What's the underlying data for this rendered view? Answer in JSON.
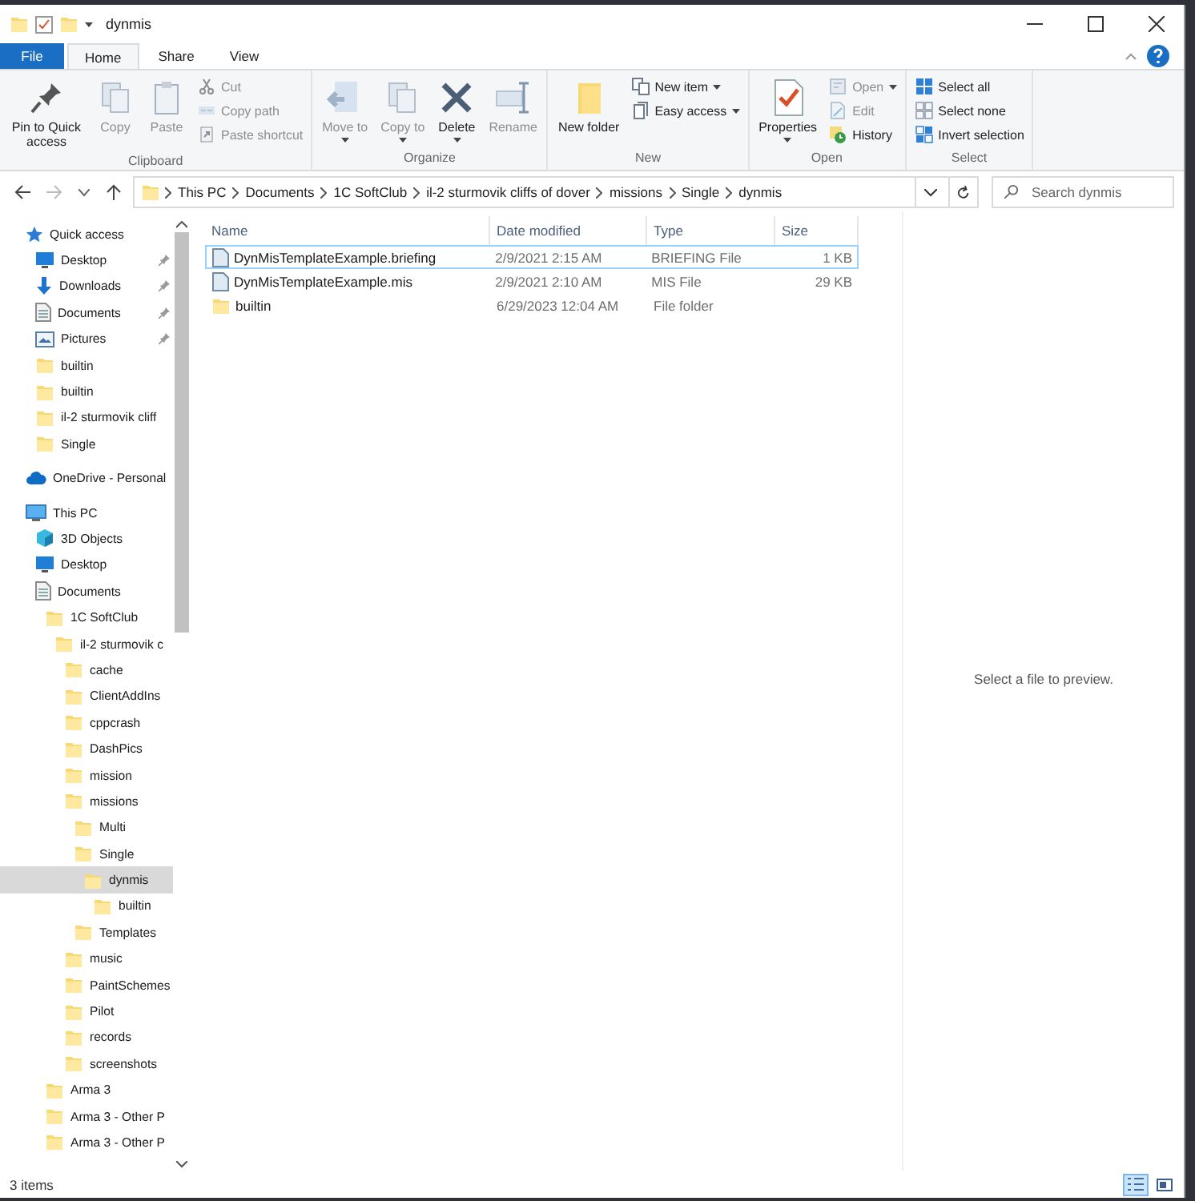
{
  "window": {
    "title": "dynmis"
  },
  "ribbon_tabs": [
    {
      "label": "File",
      "kind": "file",
      "selected": false
    },
    {
      "label": "Home",
      "kind": "tab",
      "selected": true
    },
    {
      "label": "Share",
      "kind": "tab",
      "selected": false
    },
    {
      "label": "View",
      "kind": "tab",
      "selected": false
    }
  ],
  "ribbon_groups": [
    {
      "label": "Clipboard",
      "items": [
        {
          "kind": "large",
          "label": "Pin to Quick access",
          "disabled": false,
          "dropdown": false
        },
        {
          "kind": "large",
          "label": "Copy",
          "disabled": true,
          "dropdown": false
        },
        {
          "kind": "large",
          "label": "Paste",
          "disabled": true,
          "dropdown": false
        },
        {
          "kind": "small",
          "label": "Cut",
          "disabled": true,
          "dropdown": false
        },
        {
          "kind": "small",
          "label": "Copy path",
          "disabled": true,
          "dropdown": false
        },
        {
          "kind": "small",
          "label": "Paste shortcut",
          "disabled": true,
          "dropdown": false
        }
      ]
    },
    {
      "label": "Organize",
      "items": [
        {
          "kind": "large",
          "label": "Move to",
          "disabled": true,
          "dropdown": true
        },
        {
          "kind": "large",
          "label": "Copy to",
          "disabled": true,
          "dropdown": true
        },
        {
          "kind": "large",
          "label": "Delete",
          "disabled": false,
          "dropdown": true
        },
        {
          "kind": "large",
          "label": "Rename",
          "disabled": true,
          "dropdown": false
        }
      ]
    },
    {
      "label": "New",
      "items": [
        {
          "kind": "large",
          "label": "New folder",
          "disabled": false,
          "dropdown": false
        },
        {
          "kind": "small",
          "label": "New item",
          "disabled": false,
          "dropdown": true
        },
        {
          "kind": "small",
          "label": "Easy access",
          "disabled": false,
          "dropdown": true
        }
      ]
    },
    {
      "label": "Open",
      "items": [
        {
          "kind": "large",
          "label": "Properties",
          "disabled": false,
          "dropdown": true
        },
        {
          "kind": "small",
          "label": "Open",
          "disabled": true,
          "dropdown": true
        },
        {
          "kind": "small",
          "label": "Edit",
          "disabled": true,
          "dropdown": false
        },
        {
          "kind": "small",
          "label": "History",
          "disabled": false,
          "dropdown": false
        }
      ]
    },
    {
      "label": "Select",
      "items": [
        {
          "kind": "small",
          "label": "Select all",
          "disabled": false,
          "dropdown": false
        },
        {
          "kind": "small",
          "label": "Select none",
          "disabled": false,
          "dropdown": false
        },
        {
          "kind": "small",
          "label": "Invert selection",
          "disabled": false,
          "dropdown": false
        }
      ]
    }
  ],
  "address_bar": {
    "path": [
      "This PC",
      "Documents",
      "1C SoftClub",
      "il-2 sturmovik cliffs of dover",
      "missions",
      "Single",
      "dynmis"
    ]
  },
  "search": {
    "placeholder": "Search dynmis"
  },
  "navigation": [
    {
      "label": "Quick access",
      "kind": "star",
      "pinned": false,
      "selected": false,
      "children": [
        {
          "label": "Desktop",
          "kind": "desktop",
          "pinned": true,
          "selected": false
        },
        {
          "label": "Downloads",
          "kind": "downloads",
          "pinned": true,
          "selected": false
        },
        {
          "label": "Documents",
          "kind": "documents",
          "pinned": true,
          "selected": false
        },
        {
          "label": "Pictures",
          "kind": "pictures",
          "pinned": true,
          "selected": false
        },
        {
          "label": "builtin",
          "kind": "folder",
          "pinned": false,
          "selected": false
        },
        {
          "label": "builtin",
          "kind": "folder",
          "pinned": false,
          "selected": false
        },
        {
          "label": "il-2 sturmovik cliff",
          "kind": "folder",
          "pinned": false,
          "selected": false
        },
        {
          "label": "Single",
          "kind": "folder",
          "pinned": false,
          "selected": false
        }
      ]
    },
    {
      "label": "OneDrive - Personal",
      "kind": "cloud",
      "pinned": false,
      "selected": false
    },
    {
      "label": "This PC",
      "kind": "pc",
      "pinned": false,
      "selected": false,
      "children": [
        {
          "label": "3D Objects",
          "kind": "cube",
          "pinned": false,
          "selected": false
        },
        {
          "label": "Desktop",
          "kind": "desktop",
          "pinned": false,
          "selected": false
        },
        {
          "label": "Documents",
          "kind": "documents",
          "pinned": false,
          "selected": false,
          "children": [
            {
              "label": "1C SoftClub",
              "kind": "folder",
              "pinned": false,
              "selected": false,
              "children": [
                {
                  "label": "il-2 sturmovik c",
                  "kind": "folder",
                  "pinned": false,
                  "selected": false,
                  "children": [
                    {
                      "label": "cache",
                      "kind": "folder",
                      "pinned": false,
                      "selected": false
                    },
                    {
                      "label": "ClientAddIns",
                      "kind": "folder",
                      "pinned": false,
                      "selected": false
                    },
                    {
                      "label": "cppcrash",
                      "kind": "folder",
                      "pinned": false,
                      "selected": false
                    },
                    {
                      "label": "DashPics",
                      "kind": "folder",
                      "pinned": false,
                      "selected": false
                    },
                    {
                      "label": "mission",
                      "kind": "folder",
                      "pinned": false,
                      "selected": false
                    },
                    {
                      "label": "missions",
                      "kind": "folder",
                      "pinned": false,
                      "selected": false,
                      "children": [
                        {
                          "label": "Multi",
                          "kind": "folder",
                          "pinned": false,
                          "selected": false
                        },
                        {
                          "label": "Single",
                          "kind": "folder",
                          "pinned": false,
                          "selected": false,
                          "children": [
                            {
                              "label": "dynmis",
                              "kind": "folder",
                              "pinned": false,
                              "selected": true,
                              "children": [
                                {
                                  "label": "builtin",
                                  "kind": "folder",
                                  "pinned": false,
                                  "selected": false
                                }
                              ]
                            }
                          ]
                        },
                        {
                          "label": "Templates",
                          "kind": "folder",
                          "pinned": false,
                          "selected": false
                        }
                      ]
                    },
                    {
                      "label": "music",
                      "kind": "folder",
                      "pinned": false,
                      "selected": false
                    },
                    {
                      "label": "PaintSchemes",
                      "kind": "folder",
                      "pinned": false,
                      "selected": false
                    },
                    {
                      "label": "Pilot",
                      "kind": "folder",
                      "pinned": false,
                      "selected": false
                    },
                    {
                      "label": "records",
                      "kind": "folder",
                      "pinned": false,
                      "selected": false
                    },
                    {
                      "label": "screenshots",
                      "kind": "folder",
                      "pinned": false,
                      "selected": false
                    }
                  ]
                }
              ]
            },
            {
              "label": "Arma 3",
              "kind": "folder",
              "pinned": false,
              "selected": false
            },
            {
              "label": "Arma 3 - Other P",
              "kind": "folder",
              "pinned": false,
              "selected": false
            },
            {
              "label": "Arma 3 - Other P",
              "kind": "folder",
              "pinned": false,
              "selected": false
            }
          ]
        }
      ]
    }
  ],
  "file_list": {
    "columns": [
      "Name",
      "Date modified",
      "Type",
      "Size"
    ],
    "rows": [
      {
        "name": "DynMisTemplateExample.briefing",
        "kind": "file",
        "date": "2/9/2021 2:15 AM",
        "type": "BRIEFING File",
        "size": "1 KB",
        "focused": true
      },
      {
        "name": "DynMisTemplateExample.mis",
        "kind": "file",
        "date": "2/9/2021 2:10 AM",
        "type": "MIS File",
        "size": "29 KB",
        "focused": false
      },
      {
        "name": "builtin",
        "kind": "folder",
        "date": "6/29/2023 12:04 AM",
        "type": "File folder",
        "size": "",
        "focused": false
      }
    ]
  },
  "preview_pane": {
    "message": "Select a file to preview."
  },
  "status_bar": {
    "item_count": "3 items",
    "view_buttons": [
      {
        "kind": "details",
        "selected": true
      },
      {
        "kind": "large-icons",
        "selected": false
      }
    ]
  }
}
